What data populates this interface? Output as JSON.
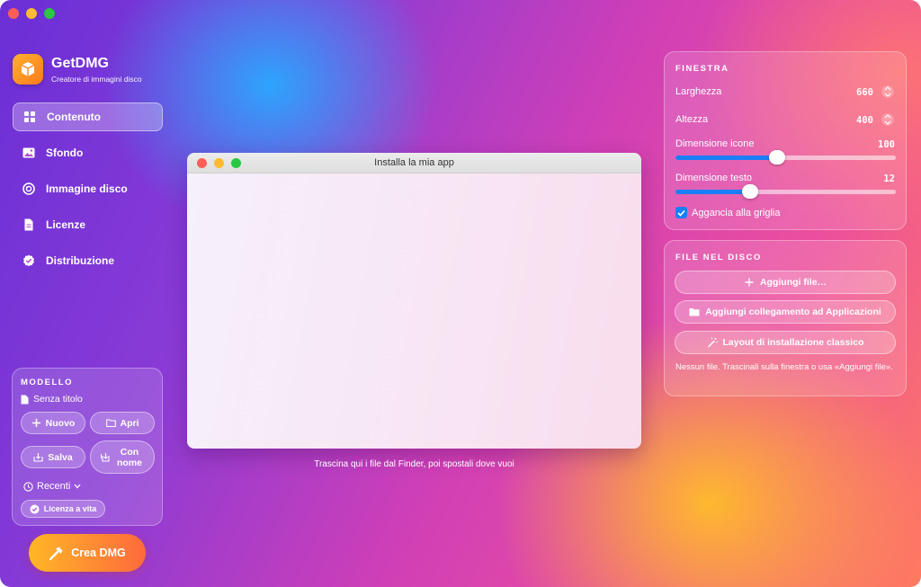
{
  "app": {
    "name": "GetDMG",
    "subtitle": "Creatore di immagini disco"
  },
  "nav": [
    {
      "label": "Contenuto",
      "icon": "grid-icon",
      "active": true
    },
    {
      "label": "Sfondo",
      "icon": "image-icon"
    },
    {
      "label": "Immagine disco",
      "icon": "disc-icon"
    },
    {
      "label": "Licenze",
      "icon": "document-icon"
    },
    {
      "label": "Distribuzione",
      "icon": "seal-check-icon"
    }
  ],
  "model": {
    "title": "MODELLO",
    "doc_name": "Senza titolo",
    "new_label": "Nuovo",
    "open_label": "Apri",
    "save_label": "Salva",
    "save_as_label": "Con nome",
    "recents_label": "Recenti",
    "license_badge": "Licenza a vita"
  },
  "create_button": "Crea DMG",
  "preview": {
    "window_title": "Installa la mia app",
    "hint": "Trascina qui i file dal Finder, poi spostali dove vuoi"
  },
  "window_panel": {
    "title": "FINESTRA",
    "width_label": "Larghezza",
    "width_value": "660",
    "height_label": "Altezza",
    "height_value": "400",
    "icon_size_label": "Dimensione icone",
    "icon_size_value": "100",
    "icon_size_fraction": 0.46,
    "text_size_label": "Dimensione testo",
    "text_size_value": "12",
    "text_size_fraction": 0.34,
    "snap_label": "Aggancia alla griglia",
    "snap_checked": true
  },
  "files_panel": {
    "title": "FILE NEL DISCO",
    "add_files": "Aggiungi file…",
    "add_app_link": "Aggiungi collegamento ad Applicazioni",
    "classic_layout": "Layout di installazione classico",
    "empty_note": "Nessun file. Trascinali sulla finestra o usa «Aggiungi file»."
  },
  "colors": {
    "accent": "#1b7ef6",
    "create_start": "#ffb626",
    "create_end": "#ff6a3d"
  }
}
